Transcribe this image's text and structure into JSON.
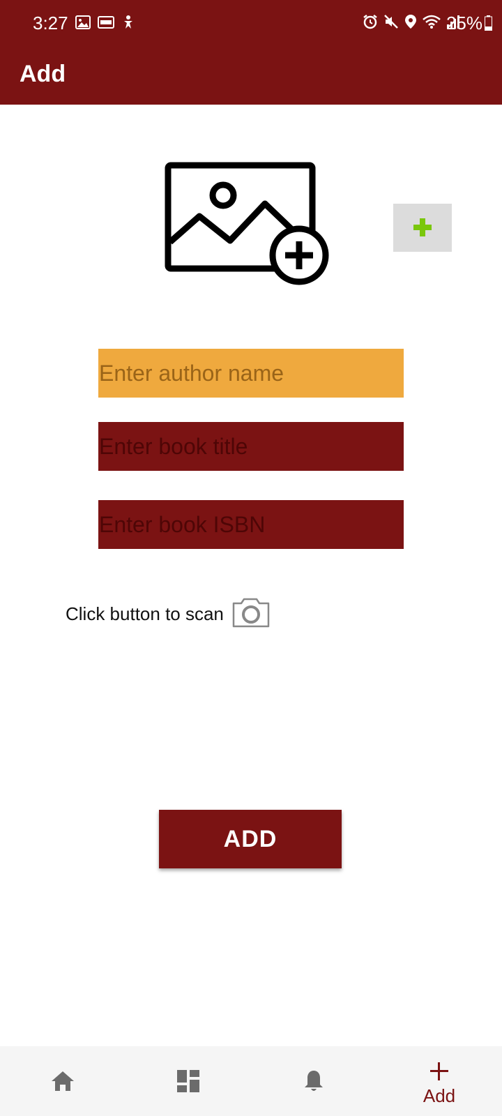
{
  "status_bar": {
    "time": "3:27",
    "battery": "25%",
    "left_icons": [
      "image-icon",
      "new-badge-icon",
      "accessibility-icon"
    ],
    "right_icons": [
      "alarm-icon",
      "mute-icon",
      "location-icon",
      "wifi-icon",
      "signal-icon",
      "battery-icon"
    ]
  },
  "app_bar": {
    "title": "Add"
  },
  "image_picker": {
    "placeholder_icon": "add-photo-icon",
    "add_button_icon": "plus-icon"
  },
  "form": {
    "author_placeholder": "Enter author name",
    "title_placeholder": "Enter book title",
    "isbn_placeholder": "Enter book ISBN",
    "author_value": "",
    "title_value": "",
    "isbn_value": "",
    "scan_label": "Click button to scan",
    "scan_icon": "camera-icon"
  },
  "add_button": {
    "label": "ADD"
  },
  "bottom_nav": {
    "items": [
      {
        "icon": "home-icon",
        "label": ""
      },
      {
        "icon": "dashboard-icon",
        "label": ""
      },
      {
        "icon": "bell-icon",
        "label": ""
      },
      {
        "icon": "plus-icon",
        "label": "Add",
        "active": true
      }
    ]
  },
  "colors": {
    "primary": "#7b1313",
    "author_field": "#efa93e",
    "image_add_button": "#dcdcdc",
    "plus_green": "#7ac70c",
    "nav_background": "#f5f5f5",
    "nav_inactive_icon": "#6b6b6b"
  }
}
